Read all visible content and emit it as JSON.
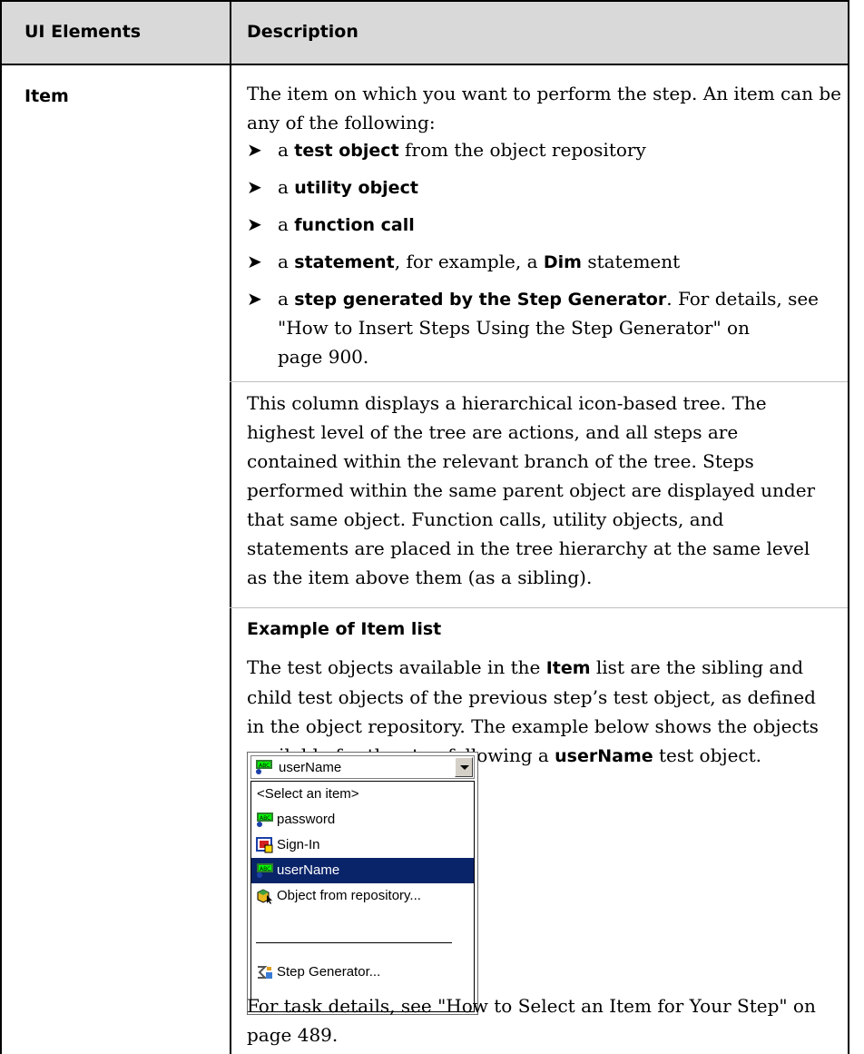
{
  "table": {
    "headers": [
      "UI Elements",
      "Description"
    ],
    "row": {
      "element": "Item",
      "intro": "The item on which you want to perform the step. An item can be any of the following:",
      "bullets": [
        [
          {
            "t": "a ",
            "b": false
          },
          {
            "t": "test object",
            "b": true
          },
          {
            "t": " from the object repository",
            "b": false
          }
        ],
        [
          {
            "t": "a ",
            "b": false
          },
          {
            "t": "utility object",
            "b": true
          }
        ],
        [
          {
            "t": "a ",
            "b": false
          },
          {
            "t": "function call",
            "b": true
          }
        ],
        [
          {
            "t": "a ",
            "b": false
          },
          {
            "t": "statement",
            "b": true
          },
          {
            "t": ", for example, a ",
            "b": false
          },
          {
            "t": "Dim",
            "b": true
          },
          {
            "t": " statement",
            "b": false
          }
        ],
        [
          {
            "t": "a ",
            "b": false
          },
          {
            "t": "step generated by the Step Generator",
            "b": true
          },
          {
            "t": ". For details, see",
            "b": false
          }
        ]
      ],
      "bullet5_cont": [
        "\"How to Insert Steps Using the Step Generator\" on",
        "page 900."
      ],
      "tree_paragraph": [
        "This column displays a hierarchical icon-based tree. The",
        "highest level of the tree are actions, and all steps are",
        "contained within the relevant branch of the tree. Steps",
        "performed within the same parent object are displayed under",
        "that same object. Function calls, utility objects, and",
        "statements are placed in the tree hierarchy at the same level",
        "as the item above them (as a sibling)."
      ],
      "example_heading": "Example of Item list",
      "example_line1_pre": "The test objects available in the ",
      "example_line1_bold": "Item",
      "example_line1_post": " list are the sibling and",
      "example_line2": "child test objects of the previous step’s test object, as defined",
      "example_line3": "in the object repository. The example below shows the objects",
      "example_line4_pre": "available for the step following a ",
      "example_line4_bold": "userName",
      "example_line4_post": " test object.",
      "footer": [
        "For task details, see \"How to Select an Item for Your Step\" on",
        "page 489."
      ]
    }
  },
  "dropdown": {
    "selected_value": "userName",
    "items": [
      {
        "label": "<Select an item>",
        "icon": "none"
      },
      {
        "label": "password",
        "icon": "edit-field-icon"
      },
      {
        "label": "Sign-In",
        "icon": "image-button-icon"
      },
      {
        "label": "userName",
        "icon": "edit-field-icon",
        "selected": true
      },
      {
        "label": "Object from repository...",
        "icon": "object-repository-icon"
      },
      {
        "label": "Step Generator...",
        "icon": "step-generator-icon"
      }
    ],
    "colors": {
      "selection": "#0a246a",
      "header_bg": "#d9d9d9"
    }
  }
}
